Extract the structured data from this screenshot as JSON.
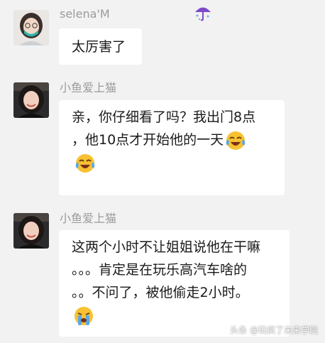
{
  "messages": [
    {
      "sender": "selena'M",
      "lines": [
        "太厉害了"
      ],
      "emoji": [
        "umbrella-icon"
      ]
    },
    {
      "sender": "小鱼爱上猫",
      "lines": [
        "亲，你仔细看了吗？我出门8点",
        "，他10点才开始他的一天"
      ],
      "emoji": [
        "laughing-crying-face",
        "laughing-crying-face"
      ]
    },
    {
      "sender": "小鱼爱上猫",
      "lines": [
        "这两个小时不让姐姐说他在干嘛",
        "。。。肯定是在玩乐高汽车啥的",
        "。。不问了，被他偷走2小时。"
      ],
      "emoji": [
        "loudly-crying-face"
      ]
    }
  ],
  "watermark": "头条 @玩疯了未来学院",
  "colors": {
    "background": "#f2f2f2",
    "bubble": "#ffffff",
    "name_text": "#9b9b9b",
    "message_text": "#1a1a1a"
  }
}
